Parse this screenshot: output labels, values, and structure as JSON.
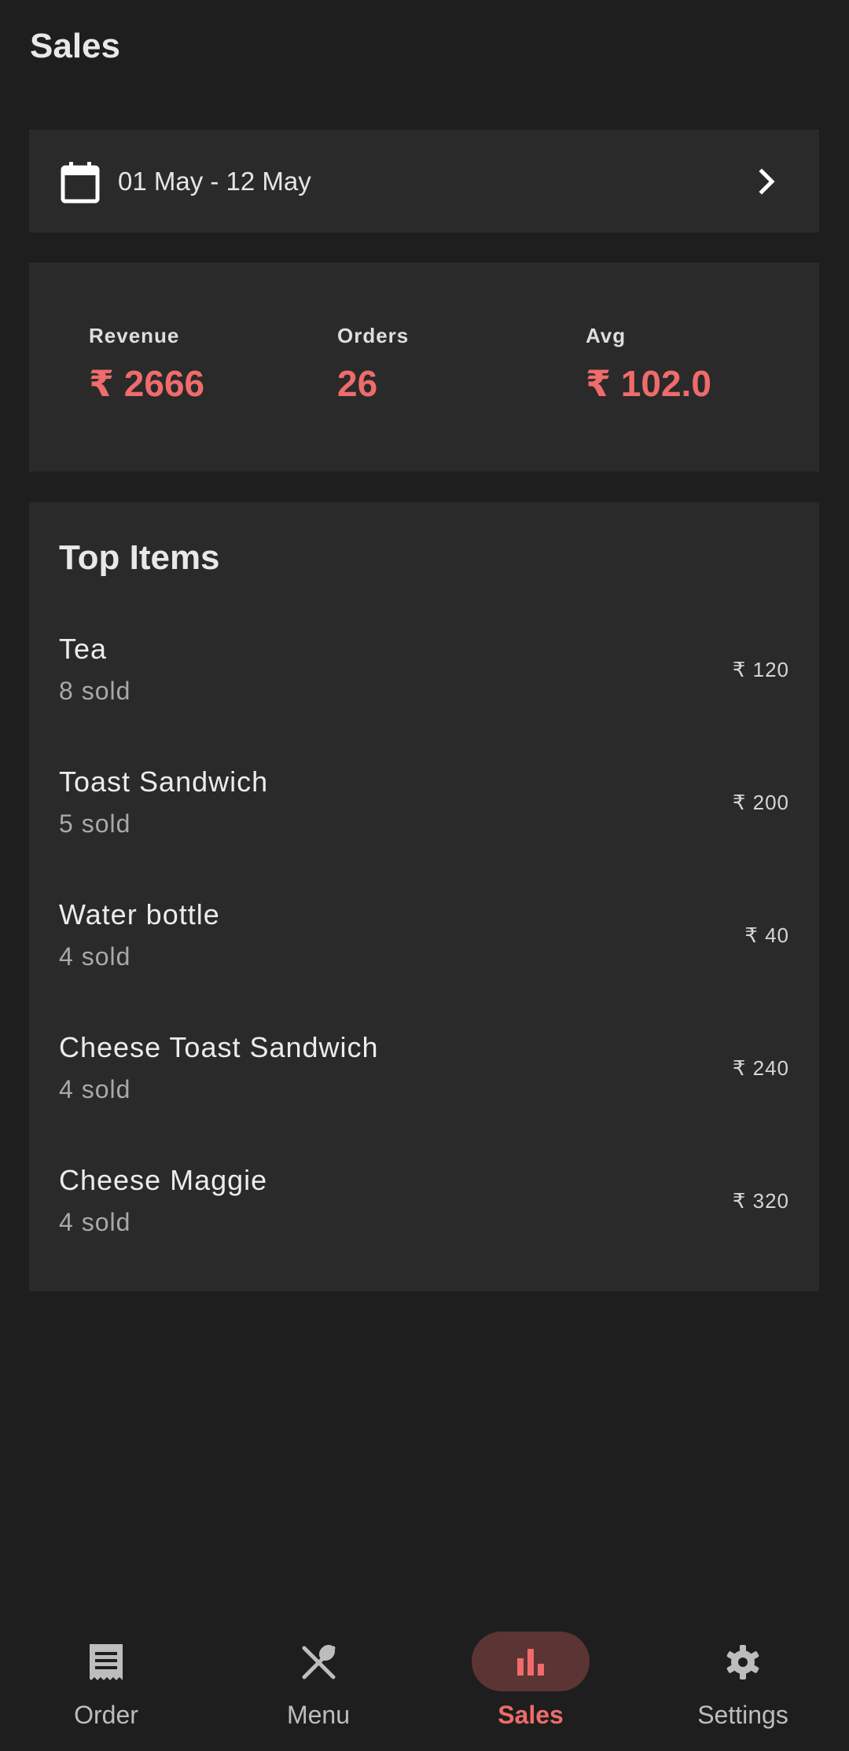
{
  "header": {
    "title": "Sales"
  },
  "date_range": {
    "label": "01 May - 12 May",
    "icon": "calendar-icon",
    "action_icon": "chevron-right-icon"
  },
  "stats": [
    {
      "label": "Revenue",
      "value": "₹ 2666"
    },
    {
      "label": "Orders",
      "value": "26"
    },
    {
      "label": "Avg",
      "value": "₹ 102.0"
    }
  ],
  "top_items": {
    "title": "Top Items",
    "items": [
      {
        "name": "Tea",
        "sold": "8 sold",
        "price": "₹ 120"
      },
      {
        "name": "Toast Sandwich",
        "sold": "5 sold",
        "price": "₹ 200"
      },
      {
        "name": "Water bottle",
        "sold": "4 sold",
        "price": "₹ 40"
      },
      {
        "name": "Cheese Toast Sandwich",
        "sold": "4 sold",
        "price": "₹ 240"
      },
      {
        "name": "Cheese Maggie",
        "sold": "4 sold",
        "price": "₹ 320"
      }
    ]
  },
  "bottom_nav": {
    "items": [
      {
        "label": "Order",
        "icon": "receipt-icon",
        "active": false
      },
      {
        "label": "Menu",
        "icon": "restaurant-icon",
        "active": false
      },
      {
        "label": "Sales",
        "icon": "bar-chart-icon",
        "active": true
      },
      {
        "label": "Settings",
        "icon": "gear-icon",
        "active": false
      }
    ]
  },
  "colors": {
    "background": "#1e1e1e",
    "card": "#2a2a2a",
    "accent": "#f06b6b",
    "active_pill": "#5b3434",
    "muted_text": "#a9a9a9"
  }
}
